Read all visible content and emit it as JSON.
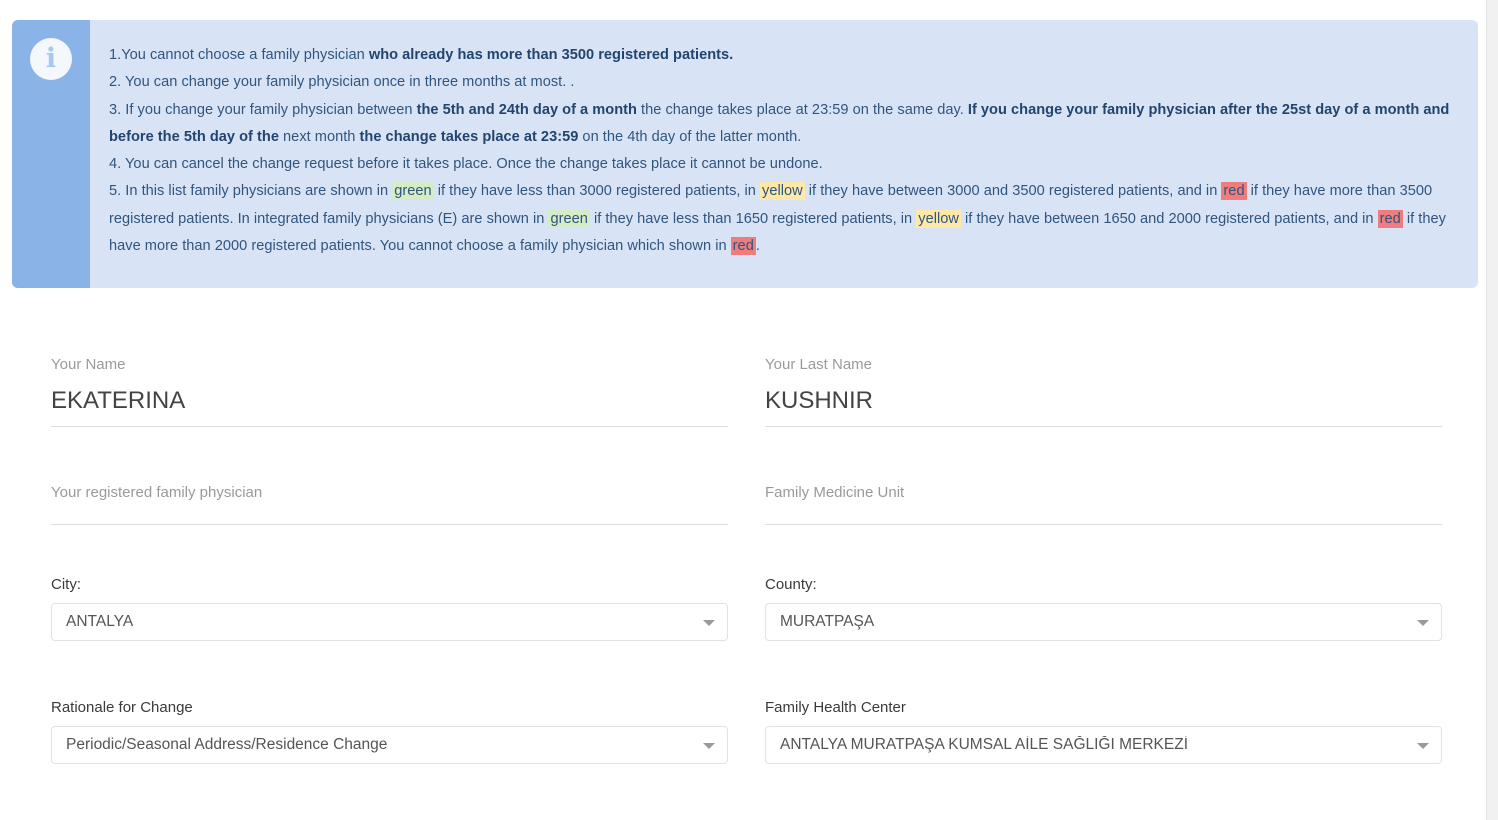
{
  "info_banner": {
    "icon": "info-icon",
    "colors": {
      "strip": "#8ab4e8",
      "body": "#d8e4f6",
      "text": "#30557f",
      "highlight_green": "#d4edc6",
      "highlight_yellow": "#fce9a7",
      "highlight_red": "#ef7d7d"
    },
    "rules": {
      "r1_a": "1.You cannot choose a family physician ",
      "r1_b": "who already has more than 3500 registered patients.",
      "r2": "2. You can change your family physician once in three months at most. .",
      "r3_a": "3. If you change your family physician between ",
      "r3_b": "the 5th and 24th day of a month",
      "r3_c": " the change takes place at 23:59 on the same day. ",
      "r3_d": "If you change your family physician after the 25st day of a month and before the 5th day of the",
      "r3_e": " next month ",
      "r3_f": "the change takes place at 23:59",
      "r3_g": " on the 4th day of the latter month.",
      "r4": "4. You can cancel the change request before it takes place. Once the change takes place it cannot be undone.",
      "r5_a": "5. In this list family physicians are shown in ",
      "r5_green1": "green",
      "r5_b": " if they have less than 3000 registered patients, in ",
      "r5_yellow1": "yellow",
      "r5_c": " if they have between 3000 and 3500 registered patients, and in ",
      "r5_red1": "red",
      "r5_d": " if they have more than 3500 registered patients. In integrated family physicians (E) are shown in ",
      "r5_green2": "green",
      "r5_e": " if they have less than 1650 registered patients, in ",
      "r5_yellow2": "yellow",
      "r5_f": " if they have between 1650 and 2000 registered patients, and in ",
      "r5_red2": "red",
      "r5_g": " if they have more than 2000 registered patients. You cannot choose a family physician which shown in ",
      "r5_red3": "red",
      "r5_h": "."
    }
  },
  "form": {
    "first_name": {
      "label": "Your Name",
      "value": "EKATERINA"
    },
    "last_name": {
      "label": "Your Last Name",
      "value": "KUSHNIR"
    },
    "registered_physician": {
      "label": "Your registered family physician",
      "value": ""
    },
    "family_medicine_unit": {
      "label": "Family Medicine Unit",
      "value": ""
    },
    "city": {
      "label": "City:",
      "value": "ANTALYA",
      "arrow": "chevron-down-icon"
    },
    "county": {
      "label": "County:",
      "value": "MURATPAŞA",
      "arrow": "chevron-down-icon"
    },
    "rationale": {
      "label": "Rationale for Change",
      "value": "Periodic/Seasonal Address/Residence Change",
      "arrow": "chevron-down-icon"
    },
    "health_center": {
      "label": "Family Health Center",
      "value": "ANTALYA MURATPAŞA KUMSAL AİLE SAĞLIĞI MERKEZİ",
      "arrow": "chevron-down-icon"
    }
  }
}
